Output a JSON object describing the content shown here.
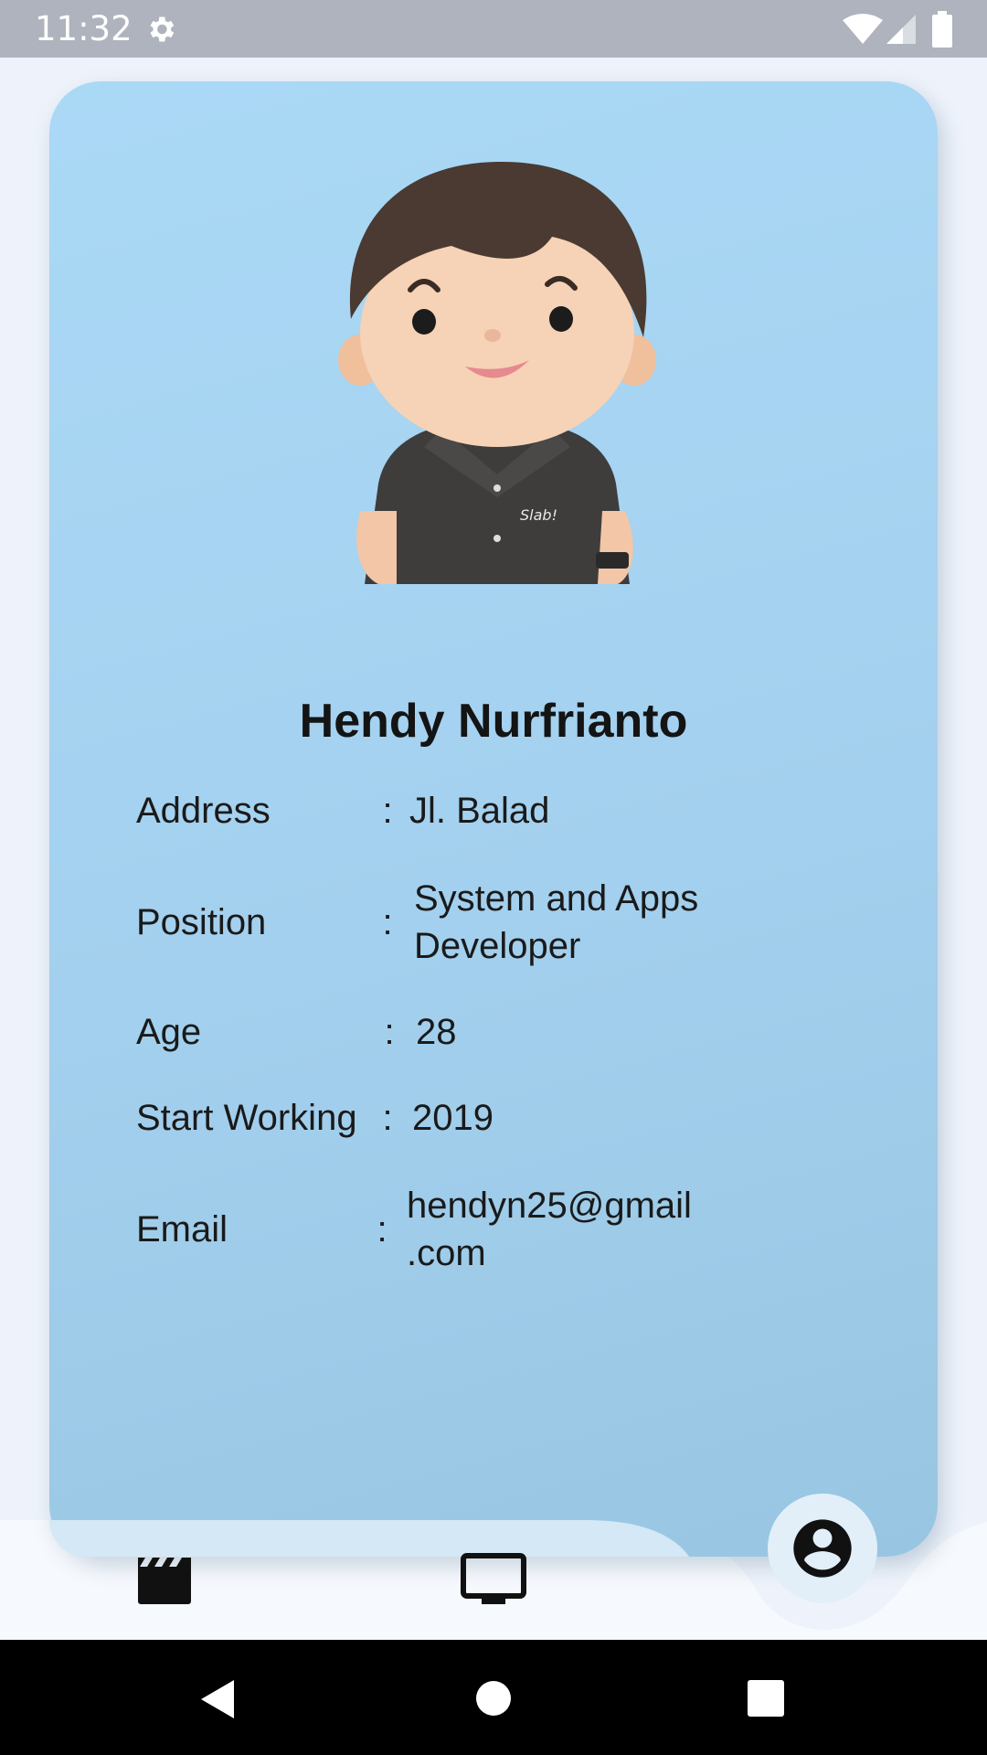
{
  "status_bar": {
    "time": "11:32",
    "icons": [
      "gear-icon",
      "wifi-icon",
      "cell-signal-icon",
      "battery-icon"
    ]
  },
  "profile": {
    "name": "Hendy Nurfrianto",
    "avatar": "3d-cartoon-avatar",
    "fields": [
      {
        "label": "Address",
        "value": "Jl. Balad"
      },
      {
        "label": "Position",
        "value_lines": [
          "System and Apps",
          "Developer"
        ]
      },
      {
        "label": "Age",
        "value": "28"
      },
      {
        "label": "Start Working",
        "value": "2019"
      },
      {
        "label": "Email",
        "value_lines": [
          "hendyn25@gmail",
          ".com"
        ]
      }
    ],
    "separator": ":"
  },
  "bottom_nav": {
    "items": [
      {
        "name": "movies",
        "icon": "clapperboard-icon",
        "active": false
      },
      {
        "name": "tv",
        "icon": "tv-icon",
        "active": false
      },
      {
        "name": "profile",
        "icon": "account-circle-icon",
        "active": true
      }
    ]
  },
  "system_nav": {
    "buttons": [
      "back-icon",
      "home-icon",
      "recents-icon"
    ]
  },
  "colors": {
    "status_bar": "#aeb3bd",
    "card_top": "#aad9f6",
    "card_bottom": "#98c6e2",
    "page_background": "#eef3fb",
    "nav_background": "#f6f9fd",
    "text": "#141414"
  }
}
